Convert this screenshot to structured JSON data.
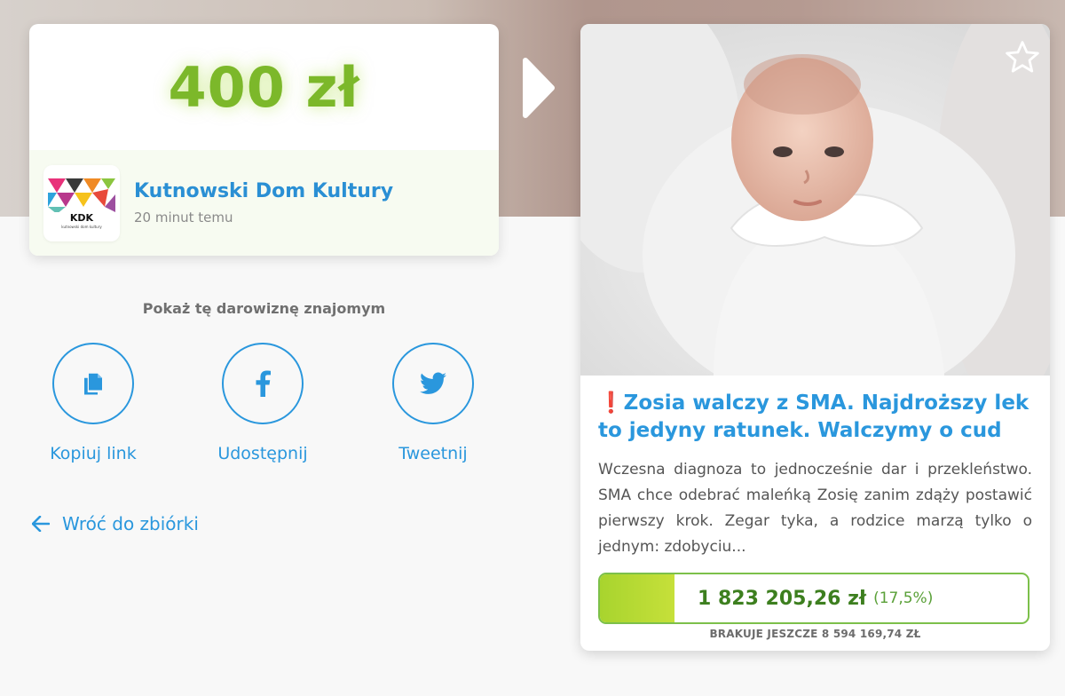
{
  "donation": {
    "amount": "400 zł",
    "donor_name": "Kutnowski Dom Kultury",
    "donor_time": "20 minut temu",
    "logo_text": "KDK",
    "logo_subtext": "kutnowski dom kultury"
  },
  "share": {
    "heading": "Pokaż tę darowiznę znajomym",
    "buttons": [
      {
        "label": "Kopiuj link",
        "icon": "copy-icon"
      },
      {
        "label": "Udostępnij",
        "icon": "facebook-icon"
      },
      {
        "label": "Tweetnij",
        "icon": "twitter-icon"
      }
    ]
  },
  "back_link": "Wróć do zbiórki",
  "campaign": {
    "title": "Zosia walczy z SMA. Najdroższy lek to jedyny ratunek. Walczymy o cud",
    "title_prefix": "❗",
    "description": "Wczesna diagnoza to jednocześnie dar i przekleństwo. SMA chce odebrać maleńką Zosię zanim zdąży postawić pierwszy krok. Zegar tyka, a rodzice marzą tylko o jednym: zdobyciu...",
    "raised": "1 823 205,26 zł",
    "percent": "(17,5%)",
    "progress_fraction": 0.175,
    "missing": "BRAKUJE JESZCZE 8 594 169,74 ZŁ"
  },
  "colors": {
    "accent_blue": "#2a97dd",
    "amount_green": "#7cb82a",
    "progress_green": "#a8d42e"
  }
}
